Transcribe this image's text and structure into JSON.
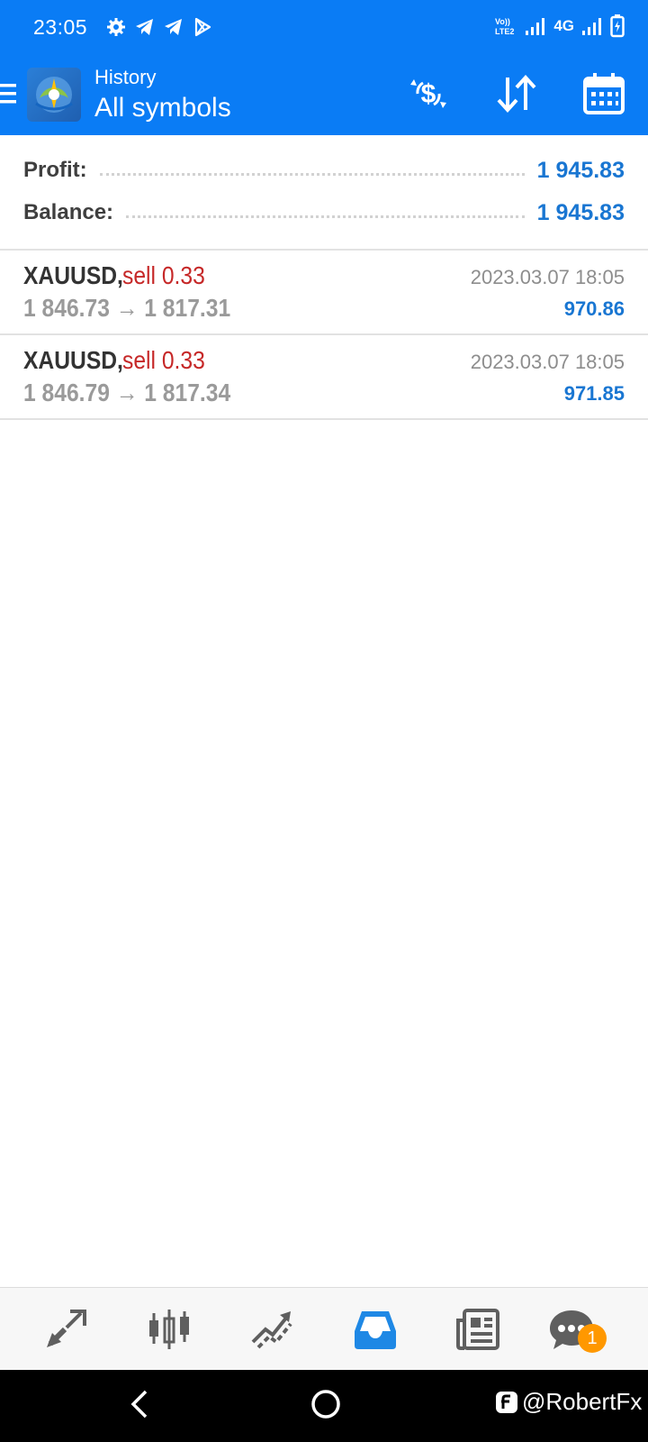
{
  "status_bar": {
    "time": "23:05",
    "left_icons": [
      "settings-icon",
      "telegram-icon",
      "telegram-icon",
      "play-store-icon"
    ],
    "network_label": "4G",
    "right_icons": [
      "volte-icon",
      "signal-icon",
      "signal-icon",
      "battery-charging-icon"
    ]
  },
  "header": {
    "subtitle": "History",
    "title": "All symbols",
    "actions": [
      "currency-exchange-icon",
      "sort-icon",
      "calendar-icon"
    ]
  },
  "summary": {
    "profit_label": "Profit:",
    "profit_value": "1 945.83",
    "balance_label": "Balance:",
    "balance_value": "1 945.83"
  },
  "deals": [
    {
      "symbol": "XAUUSD,",
      "type": "sell 0.33",
      "prices": "1 846.73 → 1 817.31",
      "time": "2023.03.07 18:05",
      "profit": "970.86"
    },
    {
      "symbol": "XAUUSD,",
      "type": "sell 0.33",
      "prices": "1 846.79 → 1 817.34",
      "time": "2023.03.07 18:05",
      "profit": "971.85"
    }
  ],
  "bottom_nav": {
    "items": [
      "quotes-icon",
      "chart-icon",
      "trade-icon",
      "history-icon",
      "news-icon",
      "chat-icon"
    ],
    "active": "history-icon",
    "chat_badge": "1"
  },
  "watermark": "@RobertFx",
  "colors": {
    "primary": "#0a7cf5",
    "profit": "#1976d2",
    "sell": "#c62828",
    "badge": "#ff9800"
  }
}
